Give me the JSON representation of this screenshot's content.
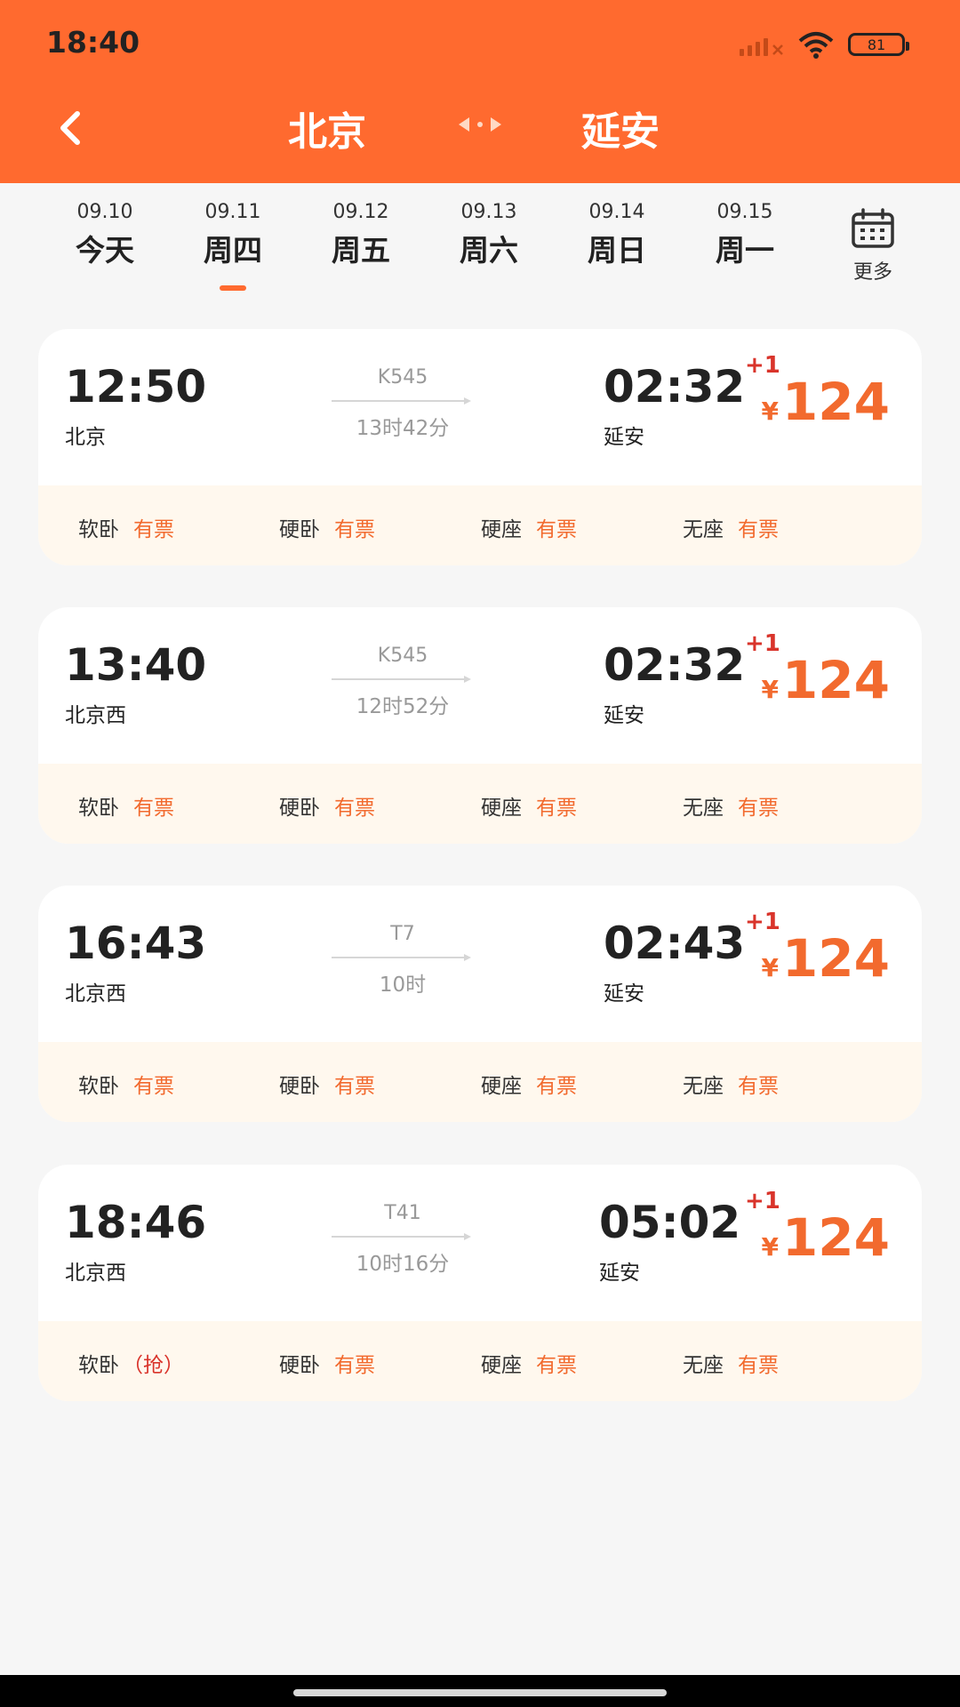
{
  "status_bar": {
    "time": "18:40",
    "battery": "81"
  },
  "header": {
    "from": "北京",
    "to": "延安"
  },
  "dates": [
    {
      "date": "09.10",
      "weekday": "今天"
    },
    {
      "date": "09.11",
      "weekday": "周四"
    },
    {
      "date": "09.12",
      "weekday": "周五"
    },
    {
      "date": "09.13",
      "weekday": "周六"
    },
    {
      "date": "09.14",
      "weekday": "周日"
    },
    {
      "date": "09.15",
      "weekday": "周一"
    }
  ],
  "more_label": "更多",
  "colors": {
    "brand": "#ff6a2f",
    "price": "#f26a2e",
    "alert": "#d9342b"
  },
  "trains": [
    {
      "dep_time": "12:50",
      "dep_station": "北京",
      "train_no": "K545",
      "duration": "13时42分",
      "arr_time": "02:32",
      "arr_station": "延安",
      "plus_day": "+1",
      "currency": "¥",
      "price": "124",
      "seats": [
        {
          "type": "软卧",
          "status": "有票"
        },
        {
          "type": "硬卧",
          "status": "有票"
        },
        {
          "type": "硬座",
          "status": "有票"
        },
        {
          "type": "无座",
          "status": "有票"
        }
      ]
    },
    {
      "dep_time": "13:40",
      "dep_station": "北京西",
      "train_no": "K545",
      "duration": "12时52分",
      "arr_time": "02:32",
      "arr_station": "延安",
      "plus_day": "+1",
      "currency": "¥",
      "price": "124",
      "seats": [
        {
          "type": "软卧",
          "status": "有票"
        },
        {
          "type": "硬卧",
          "status": "有票"
        },
        {
          "type": "硬座",
          "status": "有票"
        },
        {
          "type": "无座",
          "status": "有票"
        }
      ]
    },
    {
      "dep_time": "16:43",
      "dep_station": "北京西",
      "train_no": "T7",
      "duration": "10时",
      "arr_time": "02:43",
      "arr_station": "延安",
      "plus_day": "+1",
      "currency": "¥",
      "price": "124",
      "seats": [
        {
          "type": "软卧",
          "status": "有票"
        },
        {
          "type": "硬卧",
          "status": "有票"
        },
        {
          "type": "硬座",
          "status": "有票"
        },
        {
          "type": "无座",
          "status": "有票"
        }
      ]
    },
    {
      "dep_time": "18:46",
      "dep_station": "北京西",
      "train_no": "T41",
      "duration": "10时16分",
      "arr_time": "05:02",
      "arr_station": "延安",
      "plus_day": "+1",
      "currency": "¥",
      "price": "124",
      "seats": [
        {
          "type": "软卧",
          "status": "（抢）"
        },
        {
          "type": "硬卧",
          "status": "有票"
        },
        {
          "type": "硬座",
          "status": "有票"
        },
        {
          "type": "无座",
          "status": "有票"
        }
      ]
    }
  ]
}
